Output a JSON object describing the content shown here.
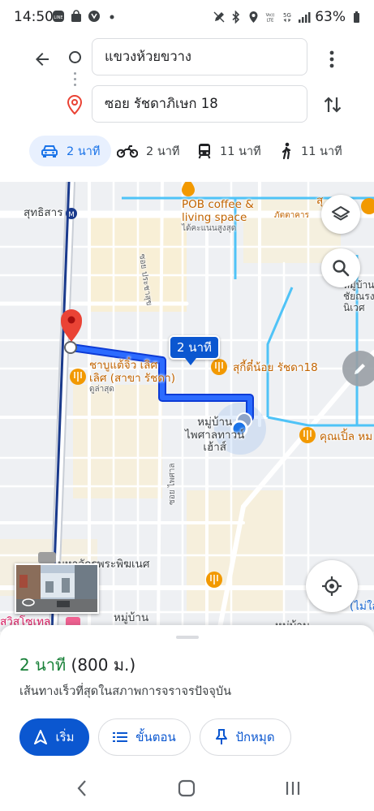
{
  "status_bar": {
    "time": "14:50",
    "battery": "63%"
  },
  "route": {
    "origin": "แขวงห้วยขวาง",
    "destination": "ซอย รัชดาภิเษก 18"
  },
  "travel_modes": [
    {
      "label": "2 นาที",
      "icon": "car-icon",
      "active": true
    },
    {
      "label": "2 นาที",
      "icon": "motorcycle-icon",
      "active": false
    },
    {
      "label": "11 นาที",
      "icon": "transit-icon",
      "active": false
    },
    {
      "label": "11 นาที",
      "icon": "walk-icon",
      "active": false
    }
  ],
  "map": {
    "route_time_chip": "2 นาที",
    "labels": {
      "station": "สุทธิสาร",
      "poi_pob_1": "POB coffee &",
      "poi_pob_2": "living space",
      "poi_pob_3": "ได้คะแนนสูงสุด",
      "poi_top_right_1": "ภัตตาคาร",
      "poi_top_right_2": "สุ",
      "road_soi_pracha": "ซอย ประชาสุข",
      "village_right_1": "หมู่บ้าน",
      "village_right_2": "ชัยณรง",
      "village_right_3": "นิเวศ",
      "poi_shabu_1": "ชาบูแต้จิ๋ว เลิศ",
      "poi_shabu_2": "เลิศ (สาขา รัชดา)",
      "poi_shabu_3": "ดูล่าสุด",
      "poi_suki": "สุกี้ตี๋น้อย รัชดา18",
      "village_mid_1": "หมู่บ้าน",
      "village_mid_2": "ไพศาลทาวน์",
      "village_mid_3": "เฮ้าส์",
      "poi_people": "คุณเปิ้ล หม",
      "road_soi_phaisan": "ซอย ไพศาล",
      "poi_temple": "มหาจักรพระพิฆเนศ",
      "poi_bottom_right": "(ไม่ใส่",
      "poi_swiss": "สวิสโซเทล",
      "village_bottom_1": "หมู่บ้าน",
      "village_bottom_2": "หมู่บ้าน"
    }
  },
  "sheet": {
    "eta_time": "2 นาที",
    "eta_distance": "(800 ม.)",
    "description": "เส้นทางเร็วที่สุดในสภาพการจราจรปัจจุบัน",
    "start_label": "เริ่ม",
    "steps_label": "ขั้นตอน",
    "pin_label": "ปักหมุด"
  },
  "colors": {
    "route": "#1a56ff",
    "accent": "#0b57d0",
    "eta": "#188038",
    "pin": "#ea4335",
    "poi": "#f29900"
  }
}
